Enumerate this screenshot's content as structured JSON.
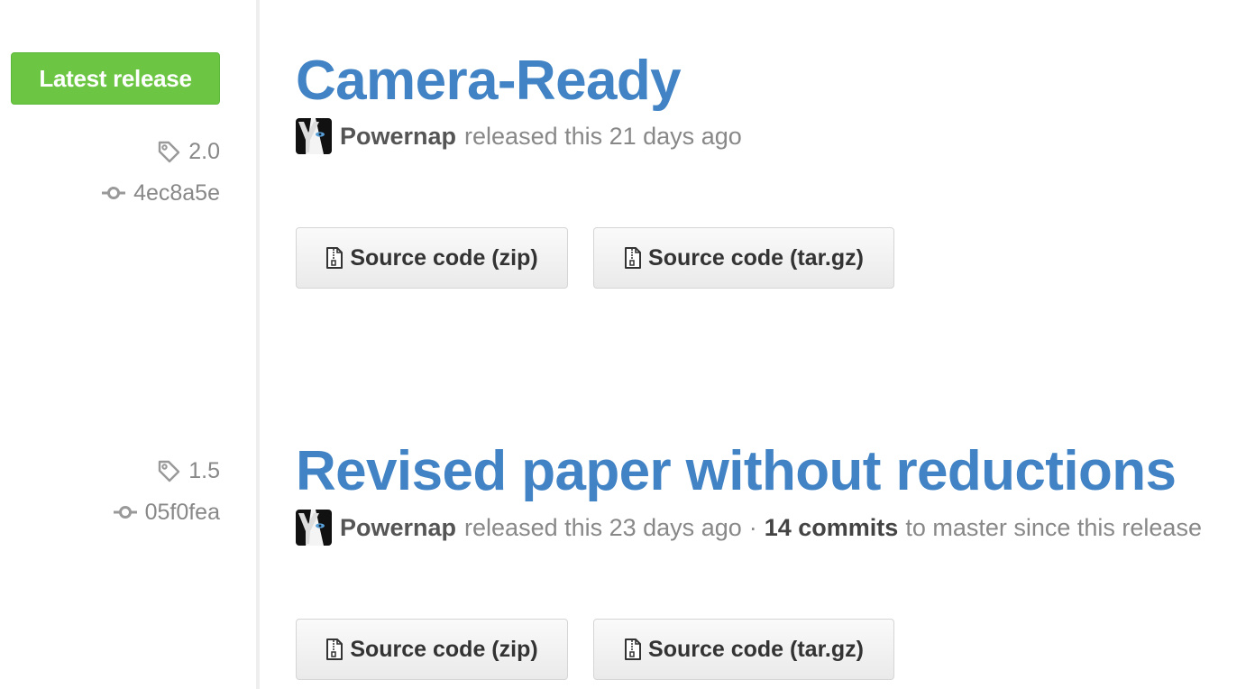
{
  "sidebar": {
    "latest_badge": "Latest release"
  },
  "releases": [
    {
      "title": "Camera-Ready",
      "tag": "2.0",
      "commit": "4ec8a5e",
      "author": "Powernap",
      "released_text": "released this 21 days ago",
      "downloads": {
        "zip_label": "Source code (zip)",
        "tar_label": "Source code (tar.gz)"
      }
    },
    {
      "title": "Revised paper without reductions",
      "tag": "1.5",
      "commit": "05f0fea",
      "author": "Powernap",
      "released_text": "released this 23 days ago",
      "separator": "·",
      "commits_count": "14 commits",
      "commits_suffix": "to master since this release",
      "downloads": {
        "zip_label": "Source code (zip)",
        "tar_label": "Source code (tar.gz)"
      }
    }
  ],
  "colors": {
    "badge_green": "#6cc644",
    "link_blue": "#4183c4",
    "muted_gray": "#888888"
  },
  "icons": {
    "tag": "tag-icon",
    "commit": "commit-icon",
    "zip_file": "file-zip-icon",
    "avatar": "avatar"
  }
}
